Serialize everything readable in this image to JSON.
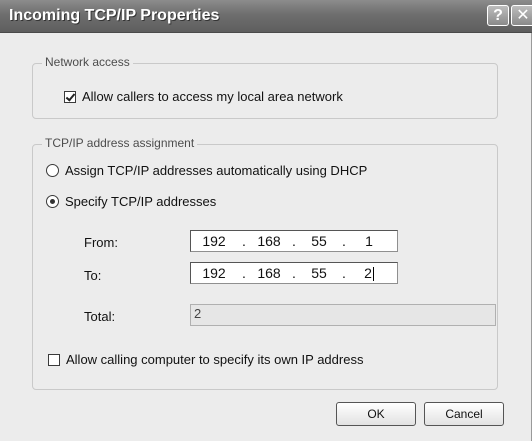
{
  "window": {
    "title": "Incoming TCP/IP Properties",
    "help_glyph": "?",
    "close_glyph": "✕"
  },
  "network_access": {
    "legend": "Network access",
    "allow_lan_label": "Allow callers to access my local area network",
    "allow_lan_checked": true
  },
  "tcpip": {
    "legend": "TCP/IP address assignment",
    "options": [
      {
        "label": "Assign TCP/IP addresses automatically using DHCP",
        "selected": false
      },
      {
        "label": "Specify TCP/IP addresses",
        "selected": true
      }
    ],
    "from": {
      "label": "From:",
      "octets": [
        "192",
        "168",
        "55",
        "1"
      ]
    },
    "to": {
      "label": "To:",
      "octets": [
        "192",
        "168",
        "55",
        "2"
      ]
    },
    "total": {
      "label": "Total:",
      "value": "2"
    },
    "allow_specify_label": "Allow calling computer to specify its own IP address",
    "allow_specify_checked": false
  },
  "buttons": {
    "ok": "OK",
    "cancel": "Cancel"
  }
}
